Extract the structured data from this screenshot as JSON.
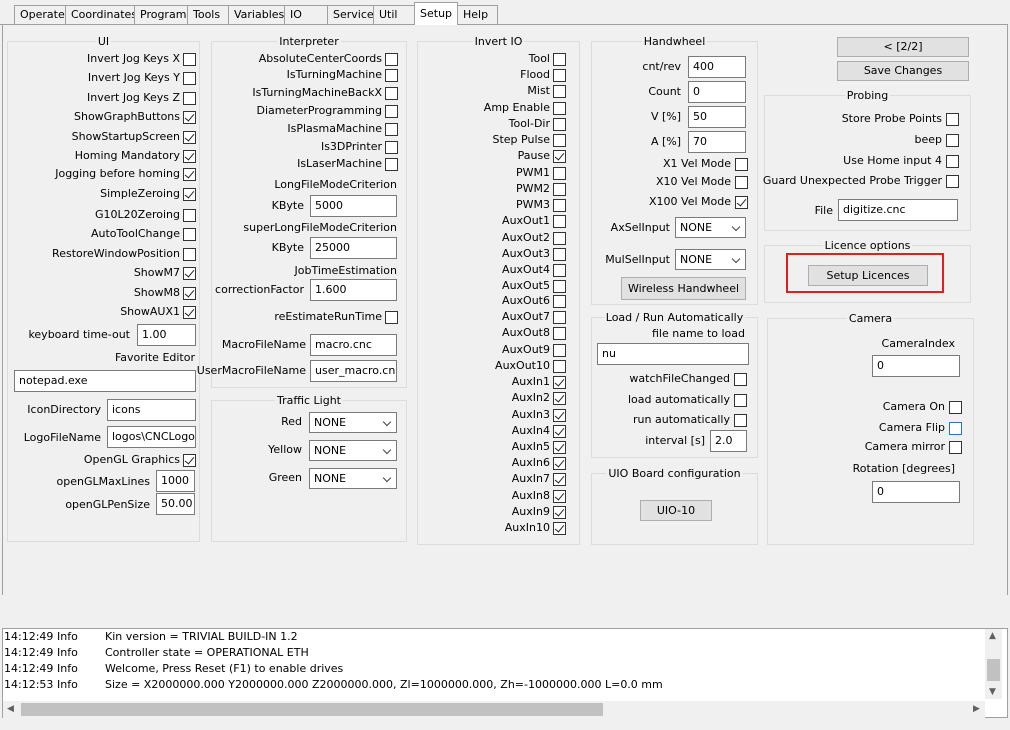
{
  "tabs": [
    "Operate",
    "Coordinates",
    "Program",
    "Tools",
    "Variables",
    "IO",
    "Service",
    "Util",
    "Setup",
    "Help"
  ],
  "ui": {
    "title": "UI",
    "items": [
      {
        "label": "Invert Jog Keys X",
        "checked": false
      },
      {
        "label": "Invert Jog Keys Y",
        "checked": false
      },
      {
        "label": "Invert Jog Keys Z",
        "checked": false
      },
      {
        "label": "ShowGraphButtons",
        "checked": true
      },
      {
        "label": "ShowStartupScreen",
        "checked": true
      },
      {
        "label": "Homing Mandatory",
        "checked": true
      },
      {
        "label": "Jogging before homing",
        "checked": true
      },
      {
        "label": "SimpleZeroing",
        "checked": true
      },
      {
        "label": "G10L20Zeroing",
        "checked": false
      },
      {
        "label": "AutoToolChange",
        "checked": false
      },
      {
        "label": "RestoreWindowPosition",
        "checked": false
      },
      {
        "label": "ShowM7",
        "checked": true
      },
      {
        "label": "ShowM8",
        "checked": true
      },
      {
        "label": "ShowAUX1",
        "checked": true
      }
    ],
    "keyboard_timeout_label": "keyboard time-out",
    "keyboard_timeout": "1.00",
    "favorite_editor_label": "Favorite Editor",
    "favorite_editor": "notepad.exe",
    "icon_directory_label": "IconDirectory",
    "icon_directory": "icons",
    "logo_file_label": "LogoFileName",
    "logo_file": "logos\\CNCLogo.p",
    "opengl_graphics_label": "OpenGL Graphics",
    "opengl_graphics": true,
    "opengl_maxlines_label": "openGLMaxLines",
    "opengl_maxlines": "1000",
    "opengl_pensize_label": "openGLPenSize",
    "opengl_pensize": "50.00"
  },
  "interpreter": {
    "title": "Interpreter",
    "items": [
      {
        "label": "AbsoluteCenterCoords",
        "checked": false
      },
      {
        "label": "IsTurningMachine",
        "checked": false
      },
      {
        "label": "IsTurningMachineBackX",
        "checked": false
      },
      {
        "label": "DiameterProgramming",
        "checked": false
      },
      {
        "label": "IsPlasmaMachine",
        "checked": false
      },
      {
        "label": "Is3DPrinter",
        "checked": false
      },
      {
        "label": "IsLaserMachine",
        "checked": false
      }
    ],
    "longfile_label": "LongFileModeCriterion",
    "kbyte_label": "KByte",
    "longfile_kbyte": "5000",
    "superlongfile_label": "superLongFileModeCriterion",
    "superlongfile_kbyte": "25000",
    "jobtime_label": "JobTimeEstimation",
    "correction_label": "correctionFactor",
    "correction_value": "1.600",
    "reestimate_label": "reEstimateRunTime",
    "reestimate": false,
    "macro_label": "MacroFileName",
    "macro_value": "macro.cnc",
    "usermacro_label": "UserMacroFileName",
    "usermacro_value": "user_macro.cnc"
  },
  "traffic": {
    "title": "Traffic Light",
    "items": [
      {
        "label": "Red",
        "value": "NONE"
      },
      {
        "label": "Yellow",
        "value": "NONE"
      },
      {
        "label": "Green",
        "value": "NONE"
      }
    ]
  },
  "invert_io": {
    "title": "Invert IO",
    "items": [
      {
        "label": "Tool",
        "checked": false
      },
      {
        "label": "Flood",
        "checked": false
      },
      {
        "label": "Mist",
        "checked": false
      },
      {
        "label": "Amp Enable",
        "checked": false
      },
      {
        "label": "Tool-Dir",
        "checked": false
      },
      {
        "label": "Step Pulse",
        "checked": false
      },
      {
        "label": "Pause",
        "checked": true
      },
      {
        "label": "PWM1",
        "checked": false
      },
      {
        "label": "PWM2",
        "checked": false
      },
      {
        "label": "PWM3",
        "checked": false
      },
      {
        "label": "AuxOut1",
        "checked": false
      },
      {
        "label": "AuxOut2",
        "checked": false
      },
      {
        "label": "AuxOut3",
        "checked": false
      },
      {
        "label": "AuxOut4",
        "checked": false
      },
      {
        "label": "AuxOut5",
        "checked": false
      },
      {
        "label": "AuxOut6",
        "checked": false
      },
      {
        "label": "AuxOut7",
        "checked": false
      },
      {
        "label": "AuxOut8",
        "checked": false
      },
      {
        "label": "AuxOut9",
        "checked": false
      },
      {
        "label": "AuxOut10",
        "checked": false
      },
      {
        "label": "AuxIn1",
        "checked": true
      },
      {
        "label": "AuxIn2",
        "checked": true
      },
      {
        "label": "AuxIn3",
        "checked": true
      },
      {
        "label": "AuxIn4",
        "checked": true
      },
      {
        "label": "AuxIn5",
        "checked": true
      },
      {
        "label": "AuxIn6",
        "checked": true
      },
      {
        "label": "AuxIn7",
        "checked": true
      },
      {
        "label": "AuxIn8",
        "checked": true
      },
      {
        "label": "AuxIn9",
        "checked": true
      },
      {
        "label": "AuxIn10",
        "checked": true
      }
    ]
  },
  "handwheel": {
    "title": "Handwheel",
    "fields": [
      {
        "label": "cnt/rev",
        "value": "400"
      },
      {
        "label": "Count",
        "value": "0"
      },
      {
        "label": "V [%]",
        "value": "50"
      },
      {
        "label": "A [%]",
        "value": "70"
      }
    ],
    "modes": [
      {
        "label": "X1 Vel Mode",
        "checked": false
      },
      {
        "label": "X10 Vel Mode",
        "checked": false
      },
      {
        "label": "X100 Vel Mode",
        "checked": true
      }
    ],
    "axsel_label": "AxSelInput",
    "axsel_value": "NONE",
    "mulsel_label": "MulSelInput",
    "mulsel_value": "NONE",
    "wireless_button": "Wireless Handwheel"
  },
  "load_run": {
    "title": "Load / Run Automatically",
    "filename_label": "file name to load",
    "filename_value": "nu",
    "items": [
      {
        "label": "watchFileChanged",
        "checked": false
      },
      {
        "label": "load automatically",
        "checked": false
      },
      {
        "label": "run automatically",
        "checked": false
      }
    ],
    "interval_label": "interval [s]",
    "interval_value": "2.0"
  },
  "uio": {
    "title": "UIO Board configuration",
    "button": "UIO-10"
  },
  "nav": {
    "page_button": "< [2/2]",
    "save_button": "Save Changes"
  },
  "probing": {
    "title": "Probing",
    "items": [
      {
        "label": "Store Probe Points",
        "checked": false
      },
      {
        "label": "beep",
        "checked": false
      },
      {
        "label": "Use Home input 4",
        "checked": false
      },
      {
        "label": "Guard Unexpected Probe Trigger",
        "checked": false
      }
    ],
    "file_label": "File",
    "file_value": "digitize.cnc"
  },
  "licence": {
    "title": "Licence options",
    "button": "Setup Licences"
  },
  "camera": {
    "title": "Camera",
    "index_label": "CameraIndex",
    "index_value": "0",
    "items": [
      {
        "label": "Camera On",
        "checked": false
      },
      {
        "label": "Camera Flip",
        "checked": false
      },
      {
        "label": "Camera mirror",
        "checked": false
      }
    ],
    "rotation_label": "Rotation [degrees]",
    "rotation_value": "0"
  },
  "log": [
    {
      "time": "14:12:49",
      "level": "Info",
      "msg": "Kin version = TRIVIAL BUILD-IN 1.2"
    },
    {
      "time": "14:12:49",
      "level": "Info",
      "msg": "Controller state = OPERATIONAL ETH"
    },
    {
      "time": "14:12:49",
      "level": "Info",
      "msg": "Welcome, Press Reset (F1) to enable drives"
    },
    {
      "time": "14:12:53",
      "level": "Info",
      "msg": "Size = X2000000.000 Y2000000.000 Z2000000.000, Zl=1000000.000, Zh=-1000000.000 L=0.0 mm"
    }
  ],
  "colors": {
    "highlight": "#e02020"
  }
}
